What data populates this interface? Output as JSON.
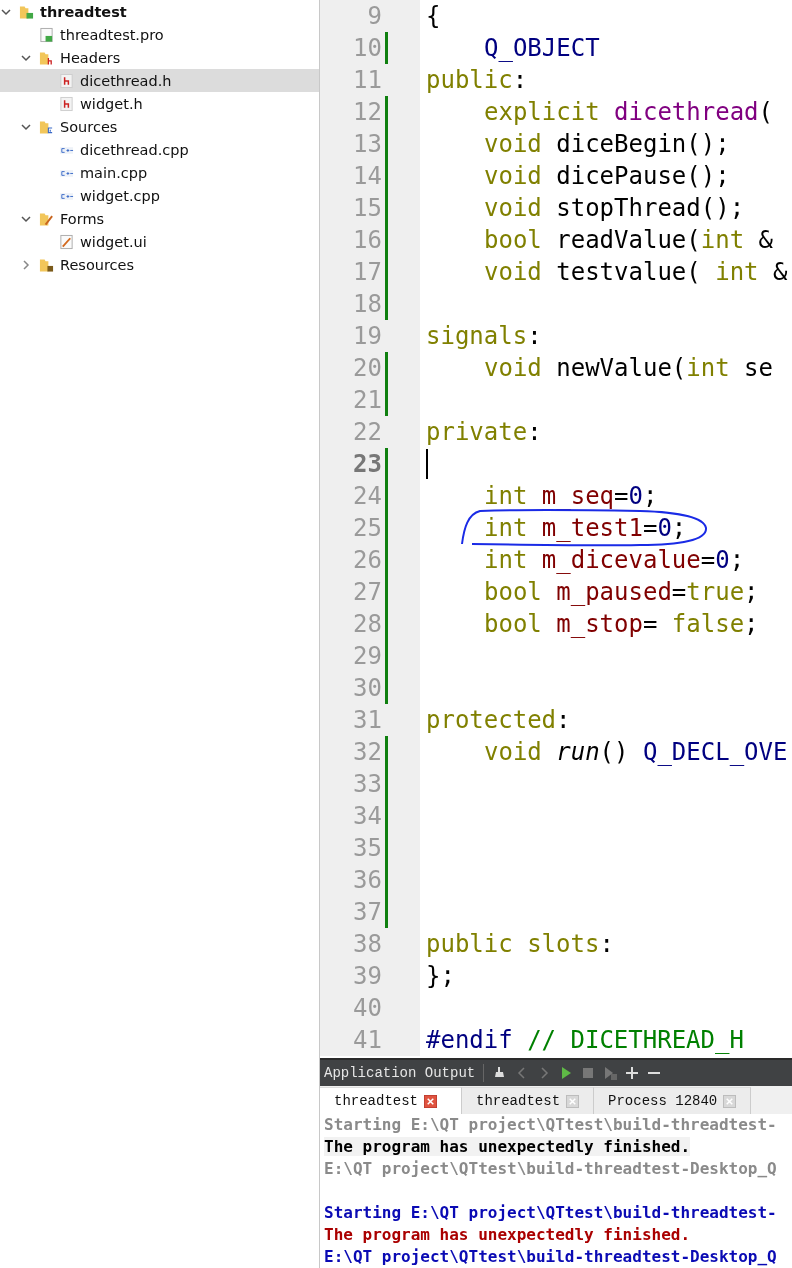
{
  "project_tree": [
    {
      "label": "threadtest",
      "kind": "project",
      "expanded": true,
      "selected": false,
      "children": [
        {
          "label": "threadtest.pro",
          "kind": "pro",
          "selected": false
        },
        {
          "label": "Headers",
          "kind": "header-folder",
          "expanded": true,
          "selected": false,
          "children": [
            {
              "label": "dicethread.h",
              "kind": "header",
              "selected": true
            },
            {
              "label": "widget.h",
              "kind": "header",
              "selected": false
            }
          ]
        },
        {
          "label": "Sources",
          "kind": "source-folder",
          "expanded": true,
          "selected": false,
          "children": [
            {
              "label": "dicethread.cpp",
              "kind": "source",
              "selected": false
            },
            {
              "label": "main.cpp",
              "kind": "source",
              "selected": false
            },
            {
              "label": "widget.cpp",
              "kind": "source",
              "selected": false
            }
          ]
        },
        {
          "label": "Forms",
          "kind": "form-folder",
          "expanded": true,
          "selected": false,
          "children": [
            {
              "label": "widget.ui",
              "kind": "form",
              "selected": false
            }
          ]
        },
        {
          "label": "Resources",
          "kind": "resource-folder",
          "expanded": false,
          "selected": false
        }
      ]
    }
  ],
  "editor": {
    "lines": [
      {
        "number": "9",
        "changed": false,
        "current": false,
        "circled": false,
        "indented": false,
        "tokens": [
          {
            "kind": "plain",
            "text": "{"
          }
        ]
      },
      {
        "number": "10",
        "changed": true,
        "current": false,
        "circled": false,
        "indented": true,
        "tokens": [
          {
            "kind": "macro",
            "text": "Q_OBJECT"
          }
        ]
      },
      {
        "number": "11",
        "changed": false,
        "current": false,
        "circled": false,
        "indented": false,
        "tokens": [
          {
            "kind": "keyword",
            "text": "public"
          },
          {
            "kind": "plain",
            "text": ":"
          }
        ]
      },
      {
        "number": "12",
        "changed": true,
        "current": false,
        "circled": false,
        "indented": true,
        "tokens": [
          {
            "kind": "keyword",
            "text": "explicit"
          },
          {
            "kind": "function",
            "text": " dicethread"
          },
          {
            "kind": "plain",
            "text": "("
          }
        ]
      },
      {
        "number": "13",
        "changed": true,
        "current": false,
        "circled": false,
        "indented": true,
        "tokens": [
          {
            "kind": "keyword",
            "text": "void"
          },
          {
            "kind": "plain",
            "text": " diceBegin();"
          }
        ]
      },
      {
        "number": "14",
        "changed": true,
        "current": false,
        "circled": false,
        "indented": true,
        "tokens": [
          {
            "kind": "keyword",
            "text": "void"
          },
          {
            "kind": "plain",
            "text": " dicePause();"
          }
        ]
      },
      {
        "number": "15",
        "changed": true,
        "current": false,
        "circled": false,
        "indented": true,
        "tokens": [
          {
            "kind": "keyword",
            "text": "void"
          },
          {
            "kind": "plain",
            "text": " stopThread();"
          }
        ]
      },
      {
        "number": "16",
        "changed": true,
        "current": false,
        "circled": false,
        "indented": true,
        "tokens": [
          {
            "kind": "keyword",
            "text": "bool"
          },
          {
            "kind": "plain",
            "text": " readValue("
          },
          {
            "kind": "keyword",
            "text": "int"
          },
          {
            "kind": "plain",
            "text": " &"
          }
        ]
      },
      {
        "number": "17",
        "changed": true,
        "current": false,
        "circled": false,
        "indented": true,
        "tokens": [
          {
            "kind": "keyword",
            "text": "void"
          },
          {
            "kind": "plain",
            "text": " testvalue( "
          },
          {
            "kind": "keyword",
            "text": "int"
          },
          {
            "kind": "plain",
            "text": " &"
          }
        ]
      },
      {
        "number": "18",
        "changed": true,
        "current": false,
        "circled": false
      },
      {
        "number": "19",
        "changed": false,
        "current": false,
        "circled": false,
        "indented": false,
        "tokens": [
          {
            "kind": "keyword",
            "text": "signals"
          },
          {
            "kind": "plain",
            "text": ":"
          }
        ]
      },
      {
        "number": "20",
        "changed": true,
        "current": false,
        "circled": false,
        "indented": true,
        "tokens": [
          {
            "kind": "keyword",
            "text": "void"
          },
          {
            "kind": "plain",
            "text": " newValue("
          },
          {
            "kind": "keyword",
            "text": "int"
          },
          {
            "kind": "plain",
            "text": " se"
          }
        ]
      },
      {
        "number": "21",
        "changed": true,
        "current": false,
        "circled": false
      },
      {
        "number": "22",
        "changed": false,
        "current": false,
        "circled": false,
        "indented": false,
        "tokens": [
          {
            "kind": "keyword",
            "text": "private"
          },
          {
            "kind": "plain",
            "text": ":"
          }
        ]
      },
      {
        "number": "23",
        "changed": true,
        "current": true,
        "circled": false
      },
      {
        "number": "24",
        "changed": true,
        "current": false,
        "circled": false,
        "indented": true,
        "tokens": [
          {
            "kind": "keyword",
            "text": "int"
          },
          {
            "kind": "member",
            "text": " m_seq"
          },
          {
            "kind": "plain",
            "text": "="
          },
          {
            "kind": "number",
            "text": "0"
          },
          {
            "kind": "plain",
            "text": ";"
          }
        ]
      },
      {
        "number": "25",
        "changed": true,
        "current": false,
        "circled": true,
        "indented": true,
        "tokens": [
          {
            "kind": "keyword",
            "text": "int"
          },
          {
            "kind": "member",
            "text": " m_test1"
          },
          {
            "kind": "plain",
            "text": "="
          },
          {
            "kind": "number",
            "text": "0"
          },
          {
            "kind": "plain",
            "text": ";"
          }
        ]
      },
      {
        "number": "26",
        "changed": true,
        "current": false,
        "circled": false,
        "indented": true,
        "tokens": [
          {
            "kind": "keyword",
            "text": "int"
          },
          {
            "kind": "member",
            "text": " m_dicevalue"
          },
          {
            "kind": "plain",
            "text": "="
          },
          {
            "kind": "number",
            "text": "0"
          },
          {
            "kind": "plain",
            "text": ";"
          }
        ]
      },
      {
        "number": "27",
        "changed": true,
        "current": false,
        "circled": false,
        "indented": true,
        "tokens": [
          {
            "kind": "keyword",
            "text": "bool"
          },
          {
            "kind": "member",
            "text": " m_paused"
          },
          {
            "kind": "plain",
            "text": "="
          },
          {
            "kind": "keyword",
            "text": "true"
          },
          {
            "kind": "plain",
            "text": ";"
          }
        ]
      },
      {
        "number": "28",
        "changed": true,
        "current": false,
        "circled": false,
        "indented": true,
        "tokens": [
          {
            "kind": "keyword",
            "text": "bool"
          },
          {
            "kind": "member",
            "text": " m_stop"
          },
          {
            "kind": "plain",
            "text": "= "
          },
          {
            "kind": "keyword",
            "text": "false"
          },
          {
            "kind": "plain",
            "text": ";"
          }
        ]
      },
      {
        "number": "29",
        "changed": true,
        "current": false,
        "circled": false
      },
      {
        "number": "30",
        "changed": true,
        "current": false,
        "circled": false
      },
      {
        "number": "31",
        "changed": false,
        "current": false,
        "circled": false,
        "indented": false,
        "tokens": [
          {
            "kind": "keyword",
            "text": "protected"
          },
          {
            "kind": "plain",
            "text": ":"
          }
        ]
      },
      {
        "number": "32",
        "changed": true,
        "current": false,
        "circled": false,
        "indented": true,
        "tokens": [
          {
            "kind": "keyword",
            "text": "void"
          },
          {
            "kind": "italic",
            "text": " run"
          },
          {
            "kind": "plain",
            "text": "() "
          },
          {
            "kind": "macro",
            "text": "Q_DECL_OVE"
          }
        ]
      },
      {
        "number": "33",
        "changed": true,
        "current": false,
        "circled": false
      },
      {
        "number": "34",
        "changed": true,
        "current": false,
        "circled": false
      },
      {
        "number": "35",
        "changed": true,
        "current": false,
        "circled": false
      },
      {
        "number": "36",
        "changed": true,
        "current": false,
        "circled": false
      },
      {
        "number": "37",
        "changed": true,
        "current": false,
        "circled": false
      },
      {
        "number": "38",
        "changed": false,
        "current": false,
        "circled": false,
        "indented": false,
        "tokens": [
          {
            "kind": "keyword",
            "text": "public slots"
          },
          {
            "kind": "plain",
            "text": ":"
          }
        ]
      },
      {
        "number": "39",
        "changed": false,
        "current": false,
        "circled": false,
        "indented": false,
        "tokens": [
          {
            "kind": "plain",
            "text": "};"
          }
        ]
      },
      {
        "number": "40",
        "changed": false,
        "current": false,
        "circled": false
      },
      {
        "number": "41",
        "changed": false,
        "current": false,
        "circled": false,
        "indented": false,
        "tokens": [
          {
            "kind": "macro",
            "text": "#endif"
          },
          {
            "kind": "comment",
            "text": " // DICETHREAD_H"
          }
        ]
      }
    ]
  },
  "output": {
    "title": "Application Output",
    "tabs": [
      {
        "label": "threadtest",
        "selected": true
      },
      {
        "label": "threadtest",
        "selected": false
      },
      {
        "label": "Process 12840",
        "selected": false
      }
    ],
    "lines": [
      {
        "kind": "muted",
        "text": "Starting E:\\QT project\\QTtest\\build-threadtest-"
      },
      {
        "kind": "highlight",
        "text": "The program has unexpectedly finished."
      },
      {
        "kind": "muted",
        "text": "E:\\QT project\\QTtest\\build-threadtest-Desktop_Q"
      },
      {
        "kind": "blank"
      },
      {
        "kind": "info",
        "text": "Starting E:\\QT project\\QTtest\\build-threadtest-"
      },
      {
        "kind": "error",
        "text": "The program has unexpectedly finished."
      },
      {
        "kind": "info",
        "text": "E:\\QT project\\QTtest\\build-threadtest-Desktop_Q"
      }
    ]
  }
}
